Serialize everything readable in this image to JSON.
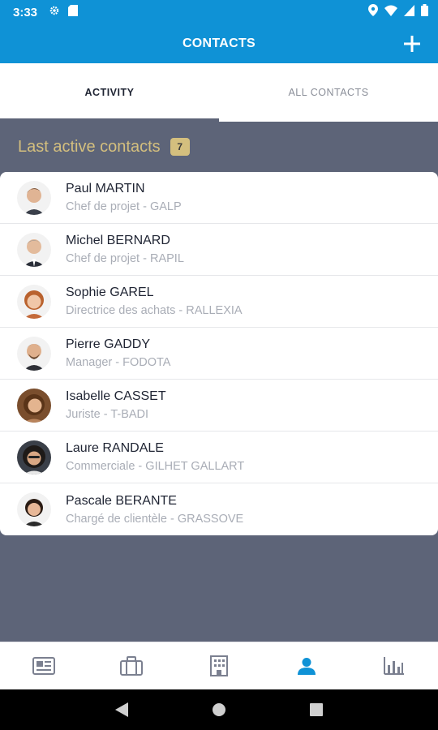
{
  "status_bar": {
    "time": "3:33"
  },
  "app_bar": {
    "title": "CONTACTS"
  },
  "tabs": [
    {
      "label": "ACTIVITY",
      "active": true
    },
    {
      "label": "ALL CONTACTS",
      "active": false
    }
  ],
  "section": {
    "title": "Last active contacts",
    "count": "7"
  },
  "contacts": [
    {
      "name": "Paul MARTIN",
      "subtitle": "Chef de projet - GALP"
    },
    {
      "name": "Michel BERNARD",
      "subtitle": "Chef de projet - RAPIL"
    },
    {
      "name": "Sophie GAREL",
      "subtitle": "Directrice des achats - RALLEXIA"
    },
    {
      "name": "Pierre GADDY",
      "subtitle": "Manager - FODOTA"
    },
    {
      "name": "Isabelle CASSET",
      "subtitle": "Juriste - T-BADI"
    },
    {
      "name": "Laure RANDALE",
      "subtitle": "Commerciale - GILHET GALLART"
    },
    {
      "name": "Pascale BERANTE",
      "subtitle": "Chargé de clientèle - GRASSOVE"
    }
  ],
  "bottom_nav": [
    {
      "icon": "newspaper-icon",
      "active": false
    },
    {
      "icon": "briefcase-icon",
      "active": false
    },
    {
      "icon": "building-icon",
      "active": false
    },
    {
      "icon": "person-icon",
      "active": true
    },
    {
      "icon": "bar-chart-icon",
      "active": false
    }
  ],
  "colors": {
    "primary": "#0f92d6",
    "background": "#5d6478",
    "accent_gold": "#d4bf7e",
    "text_dark": "#1f2433",
    "text_muted": "#a9adb6"
  }
}
